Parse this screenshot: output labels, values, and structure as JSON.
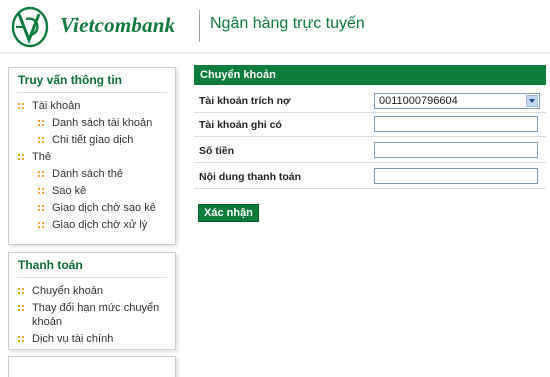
{
  "header": {
    "brand": "Vietcombank",
    "tagline": "Ngân hàng trực tuyến",
    "accent_color": "#0f7a3e",
    "logo_icon": "vietcombank-logo-icon"
  },
  "sidebar": {
    "inquiry": {
      "title": "Truy vấn thông tin",
      "items": [
        {
          "label": "Tài khoản",
          "level": 0
        },
        {
          "label": "Danh sách tài khoản",
          "level": 1
        },
        {
          "label": "Chi tiết giao dịch",
          "level": 1
        },
        {
          "label": "Thẻ",
          "level": 0
        },
        {
          "label": "Danh sách thẻ",
          "level": 1
        },
        {
          "label": "Sao kê",
          "level": 1
        },
        {
          "label": "Giao dịch chờ sao kê",
          "level": 1
        },
        {
          "label": "Giao dịch chờ xử lý",
          "level": 1
        }
      ]
    },
    "payment": {
      "title": "Thanh toán",
      "items": [
        {
          "label": "Chuyển khoản"
        },
        {
          "label": "Thay đổi hạn mức chuyển khoản"
        },
        {
          "label": "Dịch vụ tài chính"
        }
      ]
    }
  },
  "transfer": {
    "title": "Chuyển khoản",
    "fields": {
      "debit_account": {
        "label": "Tài khoản trích nợ",
        "value": "0011000796604"
      },
      "credit_account": {
        "label": "Tài khoản ghi có",
        "value": ""
      },
      "amount": {
        "label": "Số tiền",
        "value": ""
      },
      "description": {
        "label": "Nội dung thanh toán",
        "value": ""
      }
    },
    "confirm_label": "Xác nhận",
    "panel_color": "#0c7c3c"
  }
}
